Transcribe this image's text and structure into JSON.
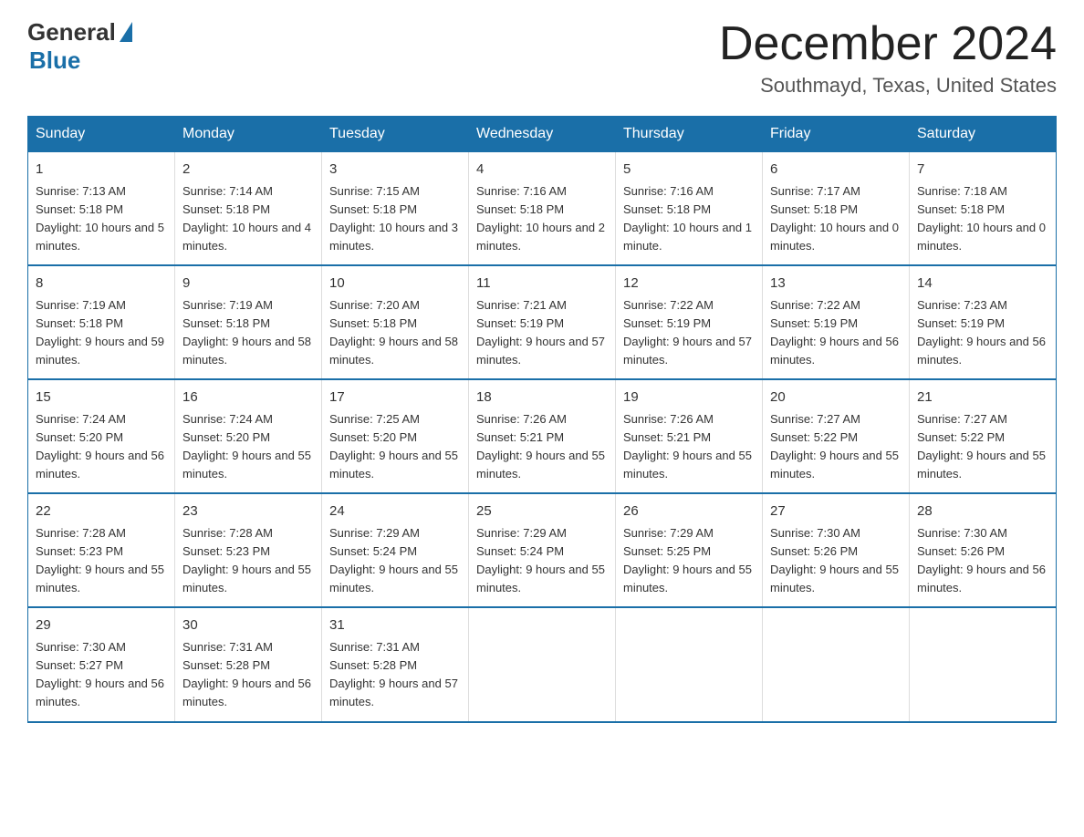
{
  "header": {
    "logo_general": "General",
    "logo_blue": "Blue",
    "title": "December 2024",
    "subtitle": "Southmayd, Texas, United States"
  },
  "days_of_week": [
    "Sunday",
    "Monday",
    "Tuesday",
    "Wednesday",
    "Thursday",
    "Friday",
    "Saturday"
  ],
  "weeks": [
    [
      {
        "day": "1",
        "sunrise": "7:13 AM",
        "sunset": "5:18 PM",
        "daylight": "10 hours and 5 minutes."
      },
      {
        "day": "2",
        "sunrise": "7:14 AM",
        "sunset": "5:18 PM",
        "daylight": "10 hours and 4 minutes."
      },
      {
        "day": "3",
        "sunrise": "7:15 AM",
        "sunset": "5:18 PM",
        "daylight": "10 hours and 3 minutes."
      },
      {
        "day": "4",
        "sunrise": "7:16 AM",
        "sunset": "5:18 PM",
        "daylight": "10 hours and 2 minutes."
      },
      {
        "day": "5",
        "sunrise": "7:16 AM",
        "sunset": "5:18 PM",
        "daylight": "10 hours and 1 minute."
      },
      {
        "day": "6",
        "sunrise": "7:17 AM",
        "sunset": "5:18 PM",
        "daylight": "10 hours and 0 minutes."
      },
      {
        "day": "7",
        "sunrise": "7:18 AM",
        "sunset": "5:18 PM",
        "daylight": "10 hours and 0 minutes."
      }
    ],
    [
      {
        "day": "8",
        "sunrise": "7:19 AM",
        "sunset": "5:18 PM",
        "daylight": "9 hours and 59 minutes."
      },
      {
        "day": "9",
        "sunrise": "7:19 AM",
        "sunset": "5:18 PM",
        "daylight": "9 hours and 58 minutes."
      },
      {
        "day": "10",
        "sunrise": "7:20 AM",
        "sunset": "5:18 PM",
        "daylight": "9 hours and 58 minutes."
      },
      {
        "day": "11",
        "sunrise": "7:21 AM",
        "sunset": "5:19 PM",
        "daylight": "9 hours and 57 minutes."
      },
      {
        "day": "12",
        "sunrise": "7:22 AM",
        "sunset": "5:19 PM",
        "daylight": "9 hours and 57 minutes."
      },
      {
        "day": "13",
        "sunrise": "7:22 AM",
        "sunset": "5:19 PM",
        "daylight": "9 hours and 56 minutes."
      },
      {
        "day": "14",
        "sunrise": "7:23 AM",
        "sunset": "5:19 PM",
        "daylight": "9 hours and 56 minutes."
      }
    ],
    [
      {
        "day": "15",
        "sunrise": "7:24 AM",
        "sunset": "5:20 PM",
        "daylight": "9 hours and 56 minutes."
      },
      {
        "day": "16",
        "sunrise": "7:24 AM",
        "sunset": "5:20 PM",
        "daylight": "9 hours and 55 minutes."
      },
      {
        "day": "17",
        "sunrise": "7:25 AM",
        "sunset": "5:20 PM",
        "daylight": "9 hours and 55 minutes."
      },
      {
        "day": "18",
        "sunrise": "7:26 AM",
        "sunset": "5:21 PM",
        "daylight": "9 hours and 55 minutes."
      },
      {
        "day": "19",
        "sunrise": "7:26 AM",
        "sunset": "5:21 PM",
        "daylight": "9 hours and 55 minutes."
      },
      {
        "day": "20",
        "sunrise": "7:27 AM",
        "sunset": "5:22 PM",
        "daylight": "9 hours and 55 minutes."
      },
      {
        "day": "21",
        "sunrise": "7:27 AM",
        "sunset": "5:22 PM",
        "daylight": "9 hours and 55 minutes."
      }
    ],
    [
      {
        "day": "22",
        "sunrise": "7:28 AM",
        "sunset": "5:23 PM",
        "daylight": "9 hours and 55 minutes."
      },
      {
        "day": "23",
        "sunrise": "7:28 AM",
        "sunset": "5:23 PM",
        "daylight": "9 hours and 55 minutes."
      },
      {
        "day": "24",
        "sunrise": "7:29 AM",
        "sunset": "5:24 PM",
        "daylight": "9 hours and 55 minutes."
      },
      {
        "day": "25",
        "sunrise": "7:29 AM",
        "sunset": "5:24 PM",
        "daylight": "9 hours and 55 minutes."
      },
      {
        "day": "26",
        "sunrise": "7:29 AM",
        "sunset": "5:25 PM",
        "daylight": "9 hours and 55 minutes."
      },
      {
        "day": "27",
        "sunrise": "7:30 AM",
        "sunset": "5:26 PM",
        "daylight": "9 hours and 55 minutes."
      },
      {
        "day": "28",
        "sunrise": "7:30 AM",
        "sunset": "5:26 PM",
        "daylight": "9 hours and 56 minutes."
      }
    ],
    [
      {
        "day": "29",
        "sunrise": "7:30 AM",
        "sunset": "5:27 PM",
        "daylight": "9 hours and 56 minutes."
      },
      {
        "day": "30",
        "sunrise": "7:31 AM",
        "sunset": "5:28 PM",
        "daylight": "9 hours and 56 minutes."
      },
      {
        "day": "31",
        "sunrise": "7:31 AM",
        "sunset": "5:28 PM",
        "daylight": "9 hours and 57 minutes."
      },
      {
        "day": "",
        "sunrise": "",
        "sunset": "",
        "daylight": ""
      },
      {
        "day": "",
        "sunrise": "",
        "sunset": "",
        "daylight": ""
      },
      {
        "day": "",
        "sunrise": "",
        "sunset": "",
        "daylight": ""
      },
      {
        "day": "",
        "sunrise": "",
        "sunset": "",
        "daylight": ""
      }
    ]
  ]
}
